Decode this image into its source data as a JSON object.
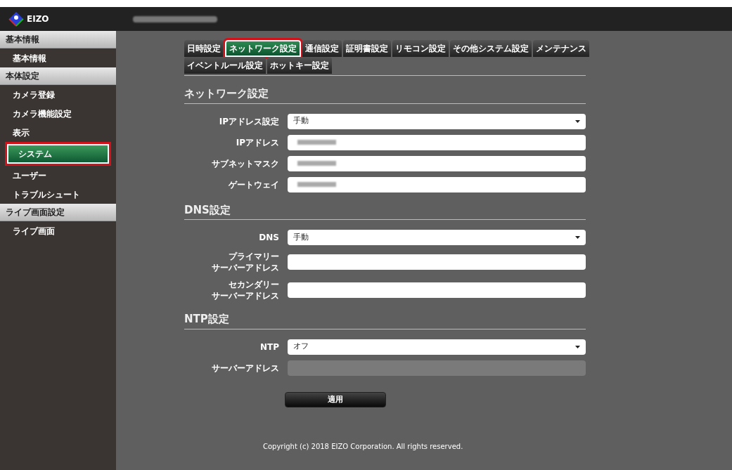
{
  "header": {
    "logo": "EIZO"
  },
  "sidebar": {
    "groups": [
      {
        "title": "基本情報",
        "items": [
          {
            "label": "基本情報",
            "selected": false,
            "highlighted": false
          }
        ]
      },
      {
        "title": "本体設定",
        "items": [
          {
            "label": "カメラ登録",
            "selected": false,
            "highlighted": false
          },
          {
            "label": "カメラ機能設定",
            "selected": false,
            "highlighted": false
          },
          {
            "label": "表示",
            "selected": false,
            "highlighted": false
          },
          {
            "label": "システム",
            "selected": true,
            "highlighted": true
          },
          {
            "label": "ユーザー",
            "selected": false,
            "highlighted": false
          },
          {
            "label": "トラブルシュート",
            "selected": false,
            "highlighted": false
          }
        ]
      },
      {
        "title": "ライブ画面設定",
        "items": [
          {
            "label": "ライブ画面",
            "selected": false,
            "highlighted": false
          }
        ]
      }
    ]
  },
  "tab_rows": [
    [
      {
        "label": "日時設定",
        "selected": false,
        "highlighted": false
      },
      {
        "label": "ネットワーク設定",
        "selected": true,
        "highlighted": true
      },
      {
        "label": "通信設定",
        "selected": false,
        "highlighted": false
      },
      {
        "label": "証明書設定",
        "selected": false,
        "highlighted": false
      },
      {
        "label": "リモコン設定",
        "selected": false,
        "highlighted": false
      },
      {
        "label": "その他システム設定",
        "selected": false,
        "highlighted": false
      },
      {
        "label": "メンテナンス",
        "selected": false,
        "highlighted": false
      }
    ],
    [
      {
        "label": "イベントルール設定",
        "selected": false,
        "highlighted": false
      },
      {
        "label": "ホットキー設定",
        "selected": false,
        "highlighted": false
      }
    ]
  ],
  "sections": [
    {
      "title": "ネットワーク設定",
      "fields": [
        {
          "kind": "select",
          "label": "IPアドレス設定",
          "value": "手動"
        },
        {
          "kind": "redacted",
          "label": "IPアドレス"
        },
        {
          "kind": "redacted",
          "label": "サブネットマスク"
        },
        {
          "kind": "redacted",
          "label": "ゲートウェイ"
        }
      ]
    },
    {
      "title": "DNS設定",
      "fields": [
        {
          "kind": "select",
          "label": "DNS",
          "value": "手動"
        },
        {
          "kind": "text",
          "label_lines": [
            "プライマリー",
            "サーバーアドレス"
          ],
          "disabled": false
        },
        {
          "kind": "text",
          "label_lines": [
            "セカンダリー",
            "サーバーアドレス"
          ],
          "disabled": false
        }
      ]
    },
    {
      "title": "NTP設定",
      "fields": [
        {
          "kind": "select",
          "label": "NTP",
          "value": "オフ"
        },
        {
          "kind": "text",
          "label": "サーバーアドレス",
          "disabled": true
        }
      ]
    }
  ],
  "apply_button": "適用",
  "footer": "Copyright (c) 2018 EIZO Corporation. All rights reserved."
}
